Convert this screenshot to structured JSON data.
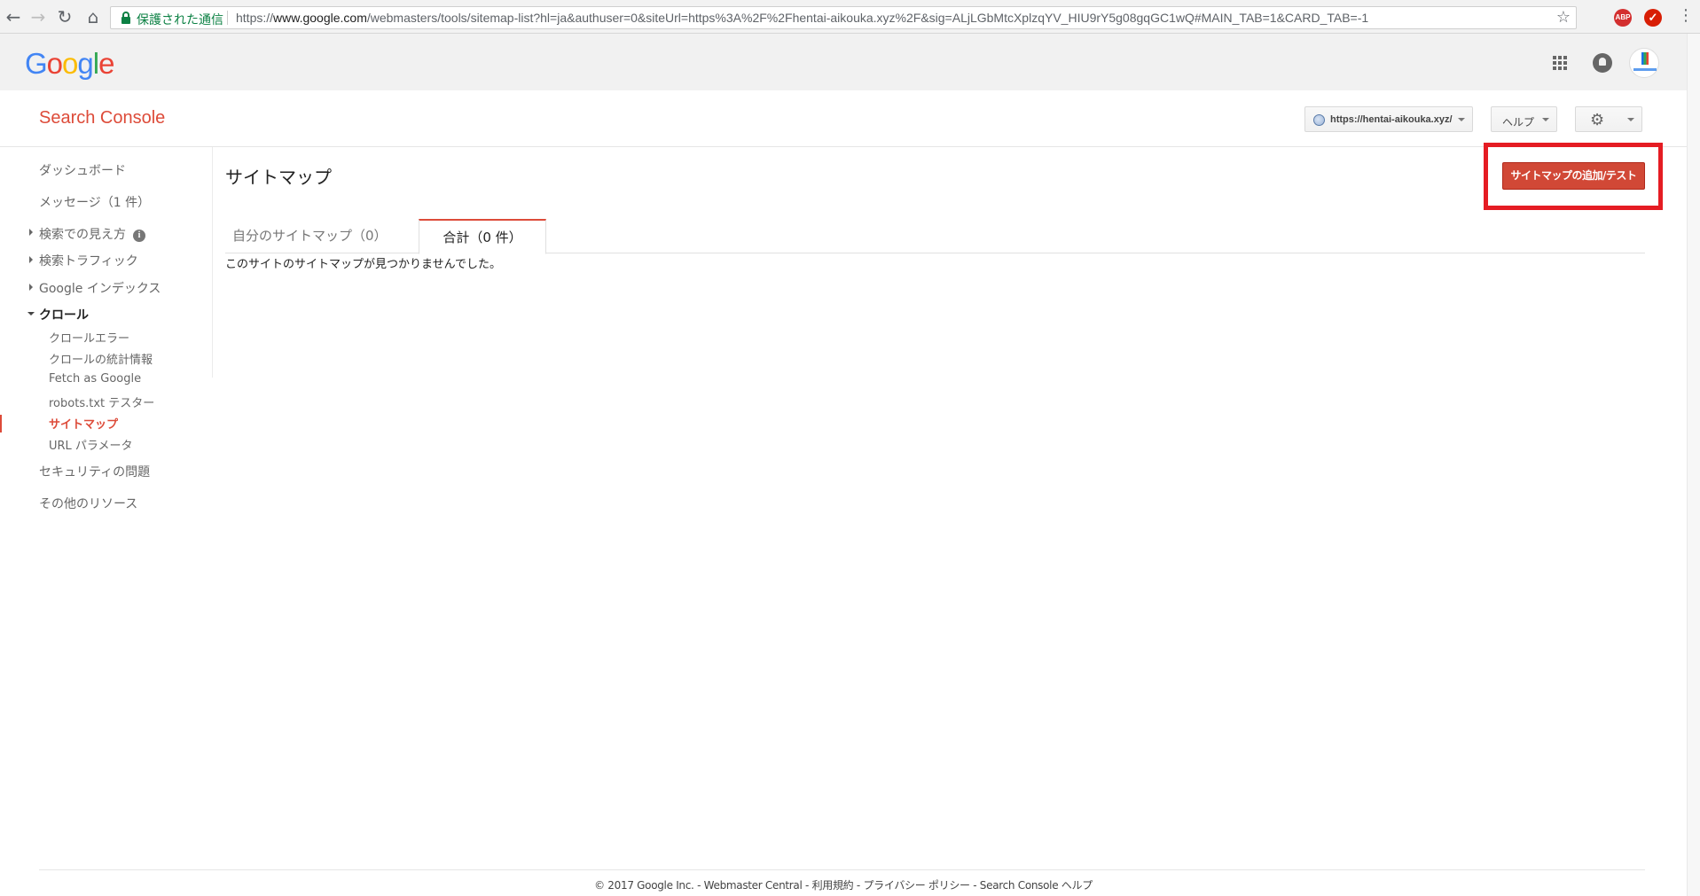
{
  "browser": {
    "secure_label": "保護された通信",
    "url_scheme": "https://",
    "url_host": "www.google.com",
    "url_path": "/webmasters/tools/sitemap-list?hl=ja&authuser=0&siteUrl=https%3A%2F%2Fhentai-aikouka.xyz%2F&sig=ALjLGbMtcXplzqYV_HIU9rY5g08gqGC1wQ#MAIN_TAB=1&CARD_TAB=-1",
    "ext_abp": "ABP"
  },
  "google_bar": {
    "logo": "Google"
  },
  "header": {
    "product_title": "Search Console",
    "site_selector": "https://hentai-aikouka.xyz/",
    "help_label": "ヘルプ"
  },
  "sidebar": {
    "dashboard": "ダッシュボード",
    "messages": "メッセージ（1 件）",
    "search_appearance": "検索での見え方",
    "search_traffic": "検索トラフィック",
    "google_index": "Google インデックス",
    "crawl": "クロール",
    "crawl_items": [
      {
        "label": "クロールエラー"
      },
      {
        "label": "クロールの統計情報"
      },
      {
        "label": "Fetch as Google"
      },
      {
        "label": "robots.txt テスター"
      },
      {
        "label": "サイトマップ"
      },
      {
        "label": "URL パラメータ"
      }
    ],
    "security": "セキュリティの問題",
    "other_resources": "その他のリソース"
  },
  "main": {
    "title": "サイトマップ",
    "add_button": "サイトマップの追加/テスト",
    "tabs": [
      {
        "label": "自分のサイトマップ（0）"
      },
      {
        "label": "合計（0 件）"
      }
    ],
    "empty_message": "このサイトのサイトマップが見つかりませんでした。"
  },
  "footer": {
    "copyright": "© 2017 Google Inc.",
    "webmaster_central": "Webmaster Central",
    "terms": "利用規約",
    "privacy": "プライバシー ポリシー",
    "help": "Search Console ヘルプ",
    "separator": " - "
  },
  "colors": {
    "accent_red": "#dd4b39",
    "button_red": "#d14836",
    "highlight_border": "#e51c23",
    "secure_green": "#0b8043"
  }
}
